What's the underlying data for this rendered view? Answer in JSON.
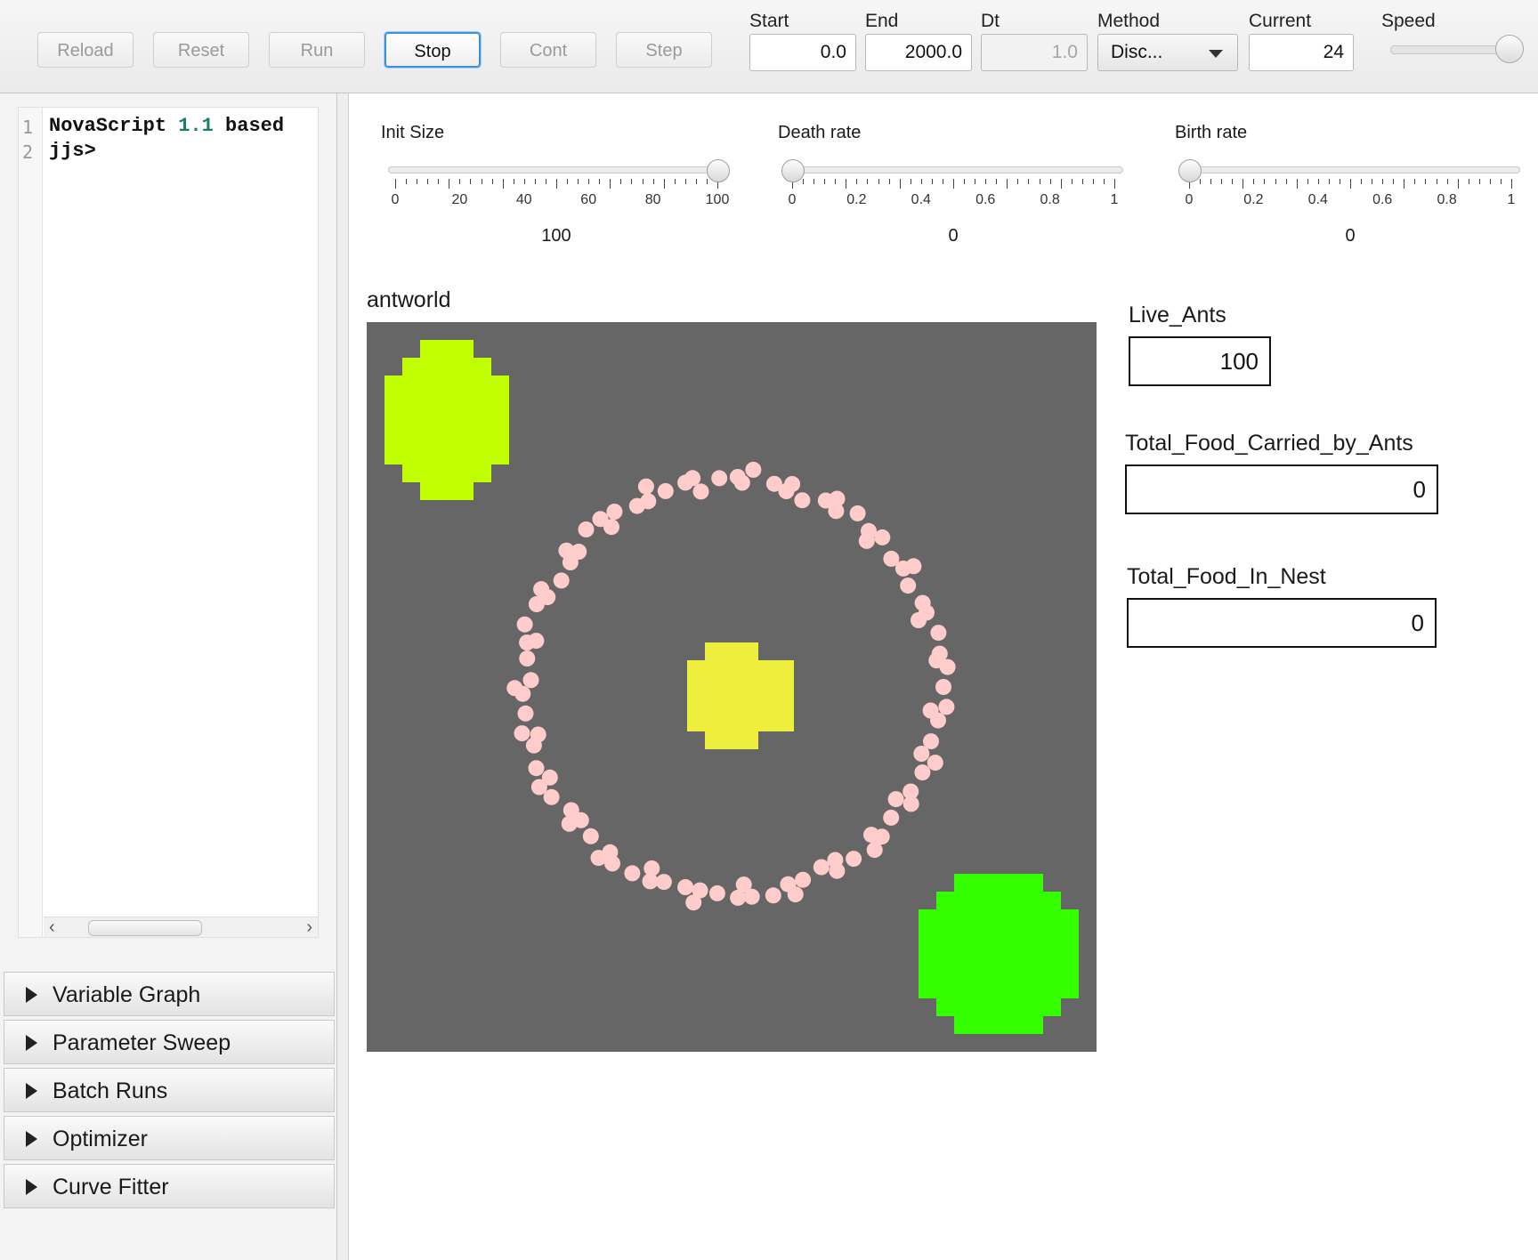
{
  "toolbar": {
    "buttons": [
      {
        "label": "Reload",
        "enabled": false
      },
      {
        "label": "Reset",
        "enabled": false
      },
      {
        "label": "Run",
        "enabled": false
      },
      {
        "label": "Stop",
        "enabled": true,
        "active": true
      },
      {
        "label": "Cont",
        "enabled": false
      },
      {
        "label": "Step",
        "enabled": false
      }
    ],
    "start": {
      "label": "Start",
      "value": "0.0"
    },
    "end": {
      "label": "End",
      "value": "2000.0"
    },
    "dt": {
      "label": "Dt",
      "value": "1.0"
    },
    "method": {
      "label": "Method",
      "value": "Disc..."
    },
    "current": {
      "label": "Current",
      "value": "24"
    },
    "speed": {
      "label": "Speed",
      "level": 1.0
    }
  },
  "console": {
    "lines": [
      {
        "num": "1",
        "text_a": "NovaScript ",
        "text_num": "1.1",
        "text_b": " based"
      },
      {
        "num": "2",
        "text_a": "jjs>",
        "text_num": "",
        "text_b": ""
      }
    ]
  },
  "accordion": [
    {
      "label": "Variable Graph"
    },
    {
      "label": "Parameter Sweep"
    },
    {
      "label": "Batch Runs"
    },
    {
      "label": "Optimizer"
    },
    {
      "label": "Curve Fitter"
    }
  ],
  "sliders": [
    {
      "label": "Init Size",
      "min": 0,
      "max": 100,
      "value": 100,
      "value_text": "100",
      "ticks": [
        "0",
        "20",
        "40",
        "60",
        "80",
        "100"
      ]
    },
    {
      "label": "Death rate",
      "min": 0,
      "max": 1,
      "value": 0,
      "value_text": "0",
      "ticks": [
        "0",
        "0.2",
        "0.4",
        "0.6",
        "0.8",
        "1"
      ]
    },
    {
      "label": "Birth rate",
      "min": 0,
      "max": 1,
      "value": 0,
      "value_text": "0",
      "ticks": [
        "0",
        "0.2",
        "0.4",
        "0.6",
        "0.8",
        "1"
      ]
    }
  ],
  "world": {
    "title": "antworld",
    "background": "#666666",
    "food_source_1_color": "#bfff00",
    "food_source_2_color": "#33ff00",
    "nest_color": "#eeee3c",
    "ant_color": "#ffcccc"
  },
  "monitors": [
    {
      "label": "Live_Ants",
      "value": "100"
    },
    {
      "label": "Total_Food_Carried_by_Ants",
      "value": "0"
    },
    {
      "label": "Total_Food_In_Nest",
      "value": "0"
    }
  ]
}
